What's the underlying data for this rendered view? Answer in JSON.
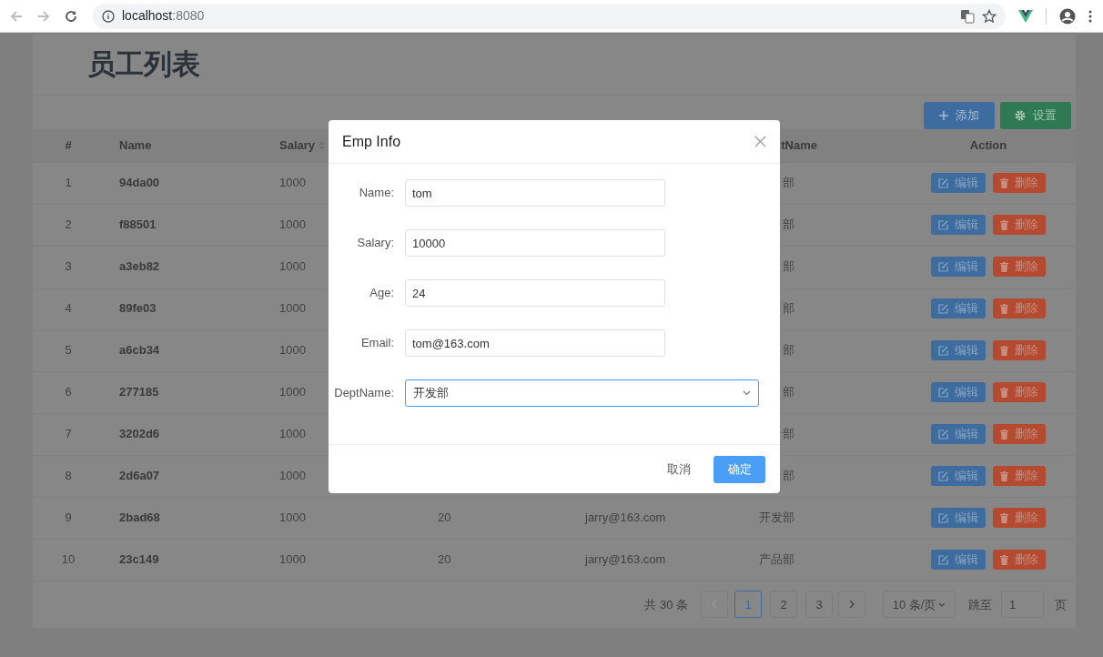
{
  "browser": {
    "url_host": "localhost",
    "url_port": ":8080"
  },
  "page": {
    "title": "员工列表",
    "toolbar": [
      {
        "kind": "add",
        "label": "添加"
      },
      {
        "kind": "settings",
        "label": "设置"
      }
    ]
  },
  "table": {
    "columns": {
      "index": "#",
      "name": "Name",
      "salary": "Salary",
      "dept": "tName",
      "action": "Action"
    },
    "rows": [
      {
        "index": "1",
        "name": "94da00",
        "salary": "1000",
        "dept": "部",
        "actions": [
          {
            "kind": "edit",
            "label": "编辑"
          },
          {
            "kind": "delete",
            "label": "删除"
          }
        ]
      },
      {
        "index": "2",
        "name": "f88501",
        "salary": "1000",
        "dept": "部",
        "actions": [
          {
            "kind": "edit",
            "label": "编辑"
          },
          {
            "kind": "delete",
            "label": "删除"
          }
        ]
      },
      {
        "index": "3",
        "name": "a3eb82",
        "salary": "1000",
        "dept": "部",
        "actions": [
          {
            "kind": "edit",
            "label": "编辑"
          },
          {
            "kind": "delete",
            "label": "删除"
          }
        ]
      },
      {
        "index": "4",
        "name": "89fe03",
        "salary": "1000",
        "dept": "部",
        "actions": [
          {
            "kind": "edit",
            "label": "编辑"
          },
          {
            "kind": "delete",
            "label": "删除"
          }
        ]
      },
      {
        "index": "5",
        "name": "a6cb34",
        "salary": "1000",
        "dept": "部",
        "actions": [
          {
            "kind": "edit",
            "label": "编辑"
          },
          {
            "kind": "delete",
            "label": "删除"
          }
        ]
      },
      {
        "index": "6",
        "name": "277185",
        "salary": "1000",
        "dept": "部",
        "actions": [
          {
            "kind": "edit",
            "label": "编辑"
          },
          {
            "kind": "delete",
            "label": "删除"
          }
        ]
      },
      {
        "index": "7",
        "name": "3202d6",
        "salary": "1000",
        "dept": "部",
        "actions": [
          {
            "kind": "edit",
            "label": "编辑"
          },
          {
            "kind": "delete",
            "label": "删除"
          }
        ]
      },
      {
        "index": "8",
        "name": "2d6a07",
        "salary": "1000",
        "dept": "部",
        "actions": [
          {
            "kind": "edit",
            "label": "编辑"
          },
          {
            "kind": "delete",
            "label": "删除"
          }
        ]
      },
      {
        "index": "9",
        "name": "2bad68",
        "salary": "1000",
        "age": "20",
        "email": "jarry@163.com",
        "dept": "开发部",
        "actions": [
          {
            "kind": "edit",
            "label": "编辑"
          },
          {
            "kind": "delete",
            "label": "删除"
          }
        ]
      },
      {
        "index": "10",
        "name": "23c149",
        "salary": "1000",
        "age": "20",
        "email": "jarry@163.com",
        "dept": "产品部",
        "actions": [
          {
            "kind": "edit",
            "label": "编辑"
          },
          {
            "kind": "delete",
            "label": "删除"
          }
        ]
      }
    ]
  },
  "pagination": {
    "total": "共 30 条",
    "prev": {
      "disabled": true
    },
    "next": {
      "disabled": false
    },
    "pages": [
      {
        "label": "1",
        "selected": true
      },
      {
        "label": "2",
        "selected": false
      },
      {
        "label": "3",
        "selected": false
      }
    ],
    "page_size": "10 条/页",
    "jump_label": "跳至",
    "jump_value": "1",
    "page_suffix": "页"
  },
  "dialog": {
    "title": "Emp Info",
    "fields": [
      {
        "kind": "input",
        "label": "Name:",
        "value": "tom",
        "focused": false
      },
      {
        "kind": "input",
        "label": "Salary:",
        "value": "10000",
        "focused": false
      },
      {
        "kind": "input",
        "label": "Age:",
        "value": "24",
        "focused": false
      },
      {
        "kind": "input",
        "label": "Email:",
        "value": "tom@163.com",
        "focused": false
      },
      {
        "kind": "select",
        "label": "DeptName:",
        "value": "开发部",
        "focused": true
      }
    ],
    "buttons": [
      {
        "kind": "cancel",
        "label": "取消"
      },
      {
        "kind": "confirm",
        "label": "确定"
      }
    ]
  }
}
